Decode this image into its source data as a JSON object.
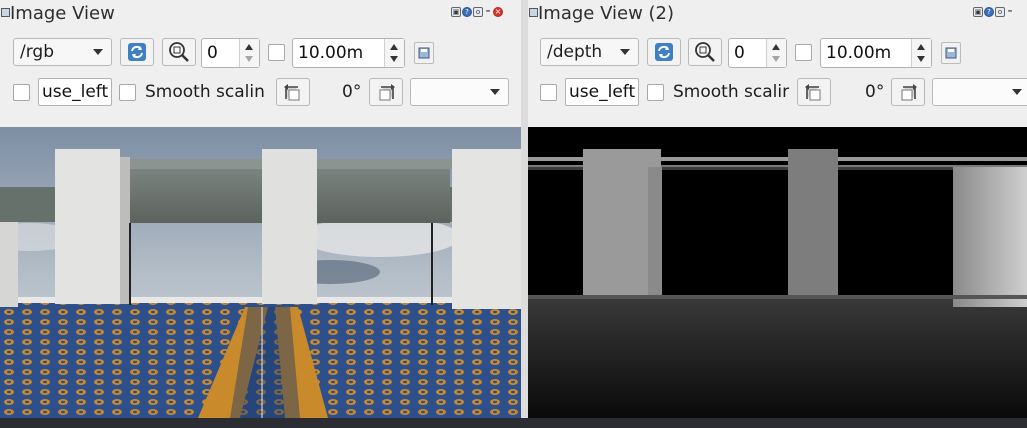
{
  "panels": [
    {
      "title": "Image View",
      "topic": "/rgb",
      "spin_value": "0",
      "max_range": "10.00m",
      "field_value": "use_left",
      "smooth_label": "Smooth scalin",
      "rotation": "0°",
      "view": "rgb"
    },
    {
      "title": "Image View (2)",
      "topic": "/depth",
      "spin_value": "0",
      "max_range": "10.00m",
      "field_value": "use_left",
      "smooth_label": "Smooth scalir",
      "rotation": "0°",
      "view": "depth"
    }
  ],
  "icons": {
    "refresh": "refresh-icon",
    "zoom": "zoom-icon",
    "save": "save-icon",
    "rotate_left": "rotate-left-icon",
    "rotate_right": "rotate-right-icon"
  },
  "colors": {
    "panel_bg": "#efefef",
    "wall_gray": "#666f6a",
    "carpet_blue": "#2d4f8c",
    "carpet_gold": "#c98a2b"
  }
}
